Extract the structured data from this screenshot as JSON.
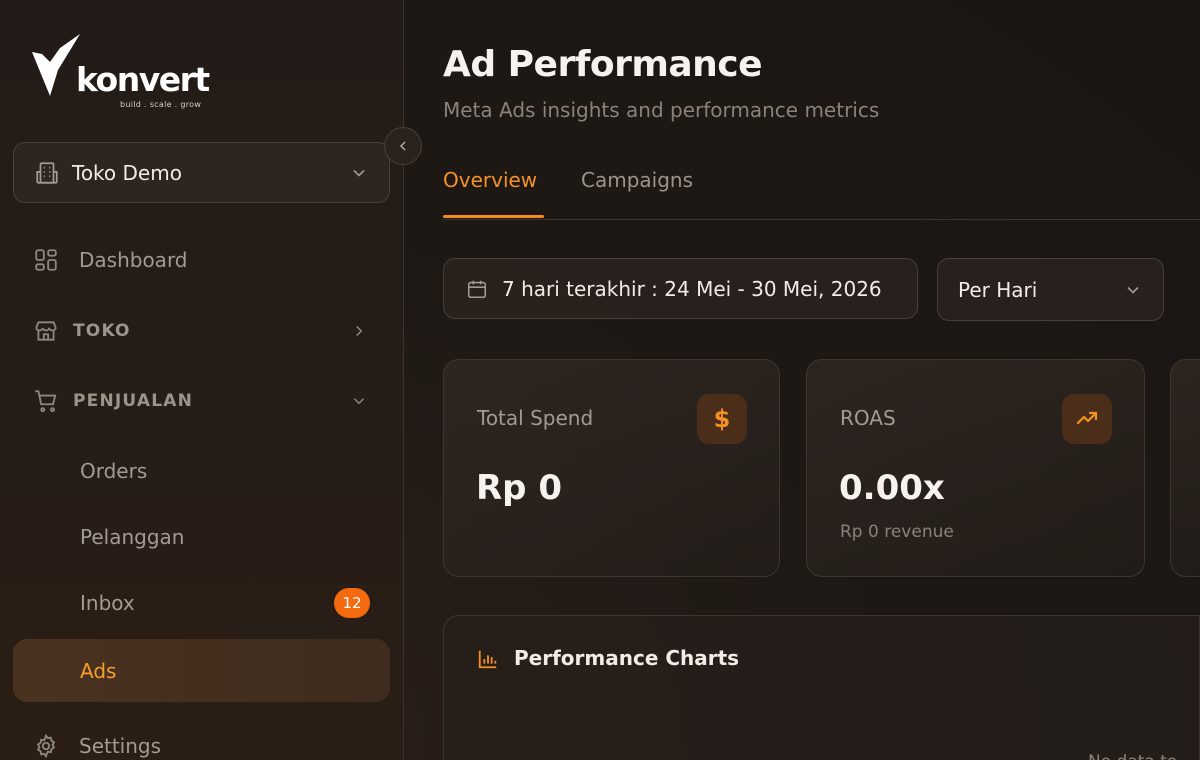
{
  "brand": {
    "name": "konvert",
    "tagline": "build . scale . grow"
  },
  "store_selector": {
    "label": "Toko Demo"
  },
  "nav": {
    "dashboard": "Dashboard",
    "toko": "TOKO",
    "penjualan": "PENJUALAN",
    "orders": "Orders",
    "pelanggan": "Pelanggan",
    "inbox": "Inbox",
    "inbox_badge": "12",
    "ads": "Ads",
    "settings": "Settings"
  },
  "header": {
    "title": "Ad Performance",
    "subtitle": "Meta Ads insights and performance metrics"
  },
  "tabs": [
    {
      "label": "Overview",
      "active": true
    },
    {
      "label": "Campaigns",
      "active": false
    }
  ],
  "filters": {
    "date_range": "7 hari terakhir : 24 Mei - 30 Mei, 2026",
    "period": "Per Hari"
  },
  "cards": [
    {
      "label": "Total Spend",
      "value": "Rp 0",
      "icon": "dollar-icon",
      "icon_glyph": "$"
    },
    {
      "label": "ROAS",
      "value": "0.00x",
      "sub": "Rp 0 revenue",
      "icon": "trending-up-icon"
    }
  ],
  "charts_panel": {
    "title": "Performance Charts",
    "empty_text": "No data to"
  },
  "colors": {
    "accent": "#f5912a",
    "badge": "#f56a0e",
    "background": "#1f1915"
  }
}
